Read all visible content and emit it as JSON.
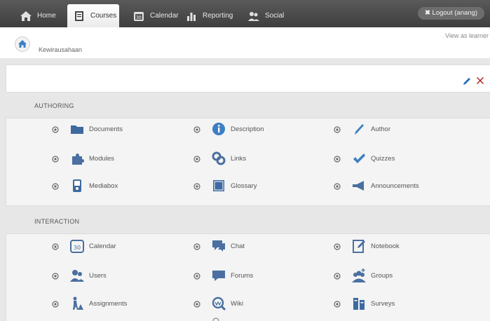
{
  "nav": {
    "tabs": [
      {
        "label": "Home",
        "icon": "home-icon",
        "active": false
      },
      {
        "label": "Courses",
        "icon": "courses-icon",
        "active": true
      },
      {
        "label": "Calendar",
        "icon": "calendar-icon",
        "active": false
      },
      {
        "label": "Reporting",
        "icon": "reporting-icon",
        "active": false
      },
      {
        "label": "Social",
        "icon": "social-icon",
        "active": false
      }
    ],
    "logout_label": "Logout (anang)",
    "calendar_number": "30"
  },
  "breadcrumb": {
    "course": "Kewirausahaan"
  },
  "view_as": "View as learner",
  "sections": {
    "authoring": {
      "title": "AUTHORING",
      "tools": [
        {
          "label": "Documents",
          "icon": "folder-icon"
        },
        {
          "label": "Description",
          "icon": "info-icon"
        },
        {
          "label": "Author",
          "icon": "pen-icon"
        },
        {
          "label": "Modules",
          "icon": "puzzle-icon"
        },
        {
          "label": "Links",
          "icon": "links-icon"
        },
        {
          "label": "Quizzes",
          "icon": "checkmark-icon"
        },
        {
          "label": "Mediabox",
          "icon": "mediabox-icon"
        },
        {
          "label": "Glossary",
          "icon": "glossary-icon"
        },
        {
          "label": "Announcements",
          "icon": "megaphone-icon"
        }
      ]
    },
    "interaction": {
      "title": "INTERACTION",
      "tools": [
        {
          "label": "Calendar",
          "icon": "calendar-icon"
        },
        {
          "label": "Chat",
          "icon": "chat-icon"
        },
        {
          "label": "Notebook",
          "icon": "notebook-icon"
        },
        {
          "label": "Users",
          "icon": "users-icon"
        },
        {
          "label": "Forums",
          "icon": "forum-icon"
        },
        {
          "label": "Groups",
          "icon": "groups-icon"
        },
        {
          "label": "Assignments",
          "icon": "assignments-icon"
        },
        {
          "label": "Wiki",
          "icon": "wiki-icon"
        },
        {
          "label": "Surveys",
          "icon": "surveys-icon"
        }
      ]
    }
  },
  "colors": {
    "navbar": "#4a4a4a",
    "accent_red": "#b02020",
    "accent_blue": "#2a6ebd",
    "icon_blue": "#3d7fc4",
    "panel_grey": "#e7e7e7"
  }
}
